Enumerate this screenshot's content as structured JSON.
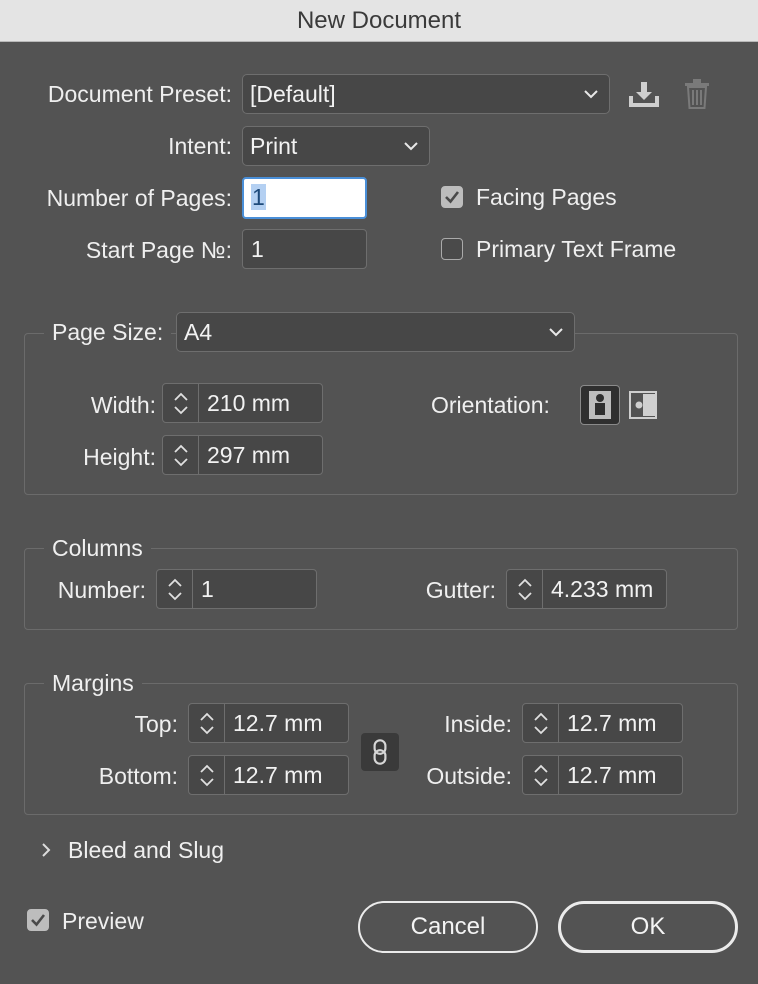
{
  "window": {
    "title": "New Document"
  },
  "preset": {
    "label": "Document Preset:",
    "value": "[Default]",
    "save_icon": "save-preset-icon",
    "delete_icon": "trash-icon"
  },
  "intent": {
    "label": "Intent:",
    "value": "Print"
  },
  "pages": {
    "number_label": "Number of Pages:",
    "number_value": "1",
    "start_label": "Start Page №:",
    "start_value": "1",
    "facing_label": "Facing Pages",
    "facing_checked": true,
    "primary_label": "Primary Text Frame",
    "primary_checked": false
  },
  "page_size": {
    "label": "Page Size:",
    "value": "A4",
    "width_label": "Width:",
    "width_value": "210 mm",
    "height_label": "Height:",
    "height_value": "297 mm",
    "orientation_label": "Orientation:",
    "orientation_selected": "portrait"
  },
  "columns": {
    "title": "Columns",
    "number_label": "Number:",
    "number_value": "1",
    "gutter_label": "Gutter:",
    "gutter_value": "4.233 mm"
  },
  "margins": {
    "title": "Margins",
    "top_label": "Top:",
    "top_value": "12.7 mm",
    "bottom_label": "Bottom:",
    "bottom_value": "12.7 mm",
    "inside_label": "Inside:",
    "inside_value": "12.7 mm",
    "outside_label": "Outside:",
    "outside_value": "12.7 mm",
    "link_icon": "chain-link-icon"
  },
  "bleed": {
    "label": "Bleed and Slug"
  },
  "footer": {
    "preview_label": "Preview",
    "preview_checked": true,
    "cancel_label": "Cancel",
    "ok_label": "OK"
  },
  "colors": {
    "background": "#535353",
    "field": "#474747",
    "focus": "#4a8fd8",
    "titlebar": "#e4e4e4"
  }
}
